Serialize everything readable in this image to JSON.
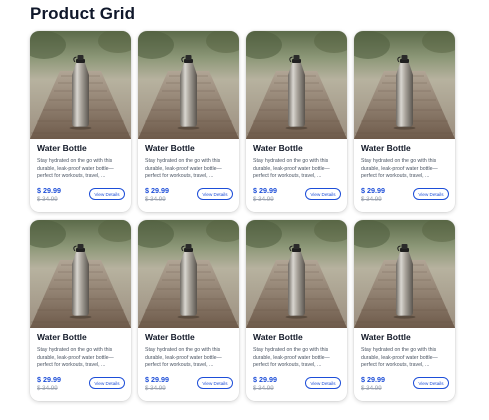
{
  "page": {
    "title": "Product Grid"
  },
  "colors": {
    "accent": "#1d4ed8",
    "muted": "#9ca3af",
    "text": "#111827"
  },
  "products": [
    {
      "name": "Water Bottle",
      "description": "Stay hydrated on the go with this durable, leak-proof water bottle—perfect for workouts, travel, ...",
      "price": "$ 29.99",
      "old_price": "$ 34.99",
      "button_label": "View Details",
      "image_icon": "water-bottle-photo"
    },
    {
      "name": "Water Bottle",
      "description": "Stay hydrated on the go with this durable, leak-proof water bottle—perfect for workouts, travel, ...",
      "price": "$ 29.99",
      "old_price": "$ 34.99",
      "button_label": "View Details",
      "image_icon": "water-bottle-photo"
    },
    {
      "name": "Water Bottle",
      "description": "Stay hydrated on the go with this durable, leak-proof water bottle—perfect for workouts, travel, ...",
      "price": "$ 29.99",
      "old_price": "$ 34.99",
      "button_label": "View Details",
      "image_icon": "water-bottle-photo"
    },
    {
      "name": "Water Bottle",
      "description": "Stay hydrated on the go with this durable, leak-proof water bottle—perfect for workouts, travel, ...",
      "price": "$ 29.99",
      "old_price": "$ 34.99",
      "button_label": "View Details",
      "image_icon": "water-bottle-photo"
    },
    {
      "name": "Water Bottle",
      "description": "Stay hydrated on the go with this durable, leak-proof water bottle—perfect for workouts, travel, ...",
      "price": "$ 29.99",
      "old_price": "$ 34.99",
      "button_label": "View Details",
      "image_icon": "water-bottle-photo"
    },
    {
      "name": "Water Bottle",
      "description": "Stay hydrated on the go with this durable, leak-proof water bottle—perfect for workouts, travel, ...",
      "price": "$ 29.99",
      "old_price": "$ 34.99",
      "button_label": "View Details",
      "image_icon": "water-bottle-photo"
    },
    {
      "name": "Water Bottle",
      "description": "Stay hydrated on the go with this durable, leak-proof water bottle—perfect for workouts, travel, ...",
      "price": "$ 29.99",
      "old_price": "$ 34.99",
      "button_label": "View Details",
      "image_icon": "water-bottle-photo"
    },
    {
      "name": "Water Bottle",
      "description": "Stay hydrated on the go with this durable, leak-proof water bottle—perfect for workouts, travel, ...",
      "price": "$ 29.99",
      "old_price": "$ 34.99",
      "button_label": "View Details",
      "image_icon": "water-bottle-photo"
    }
  ]
}
